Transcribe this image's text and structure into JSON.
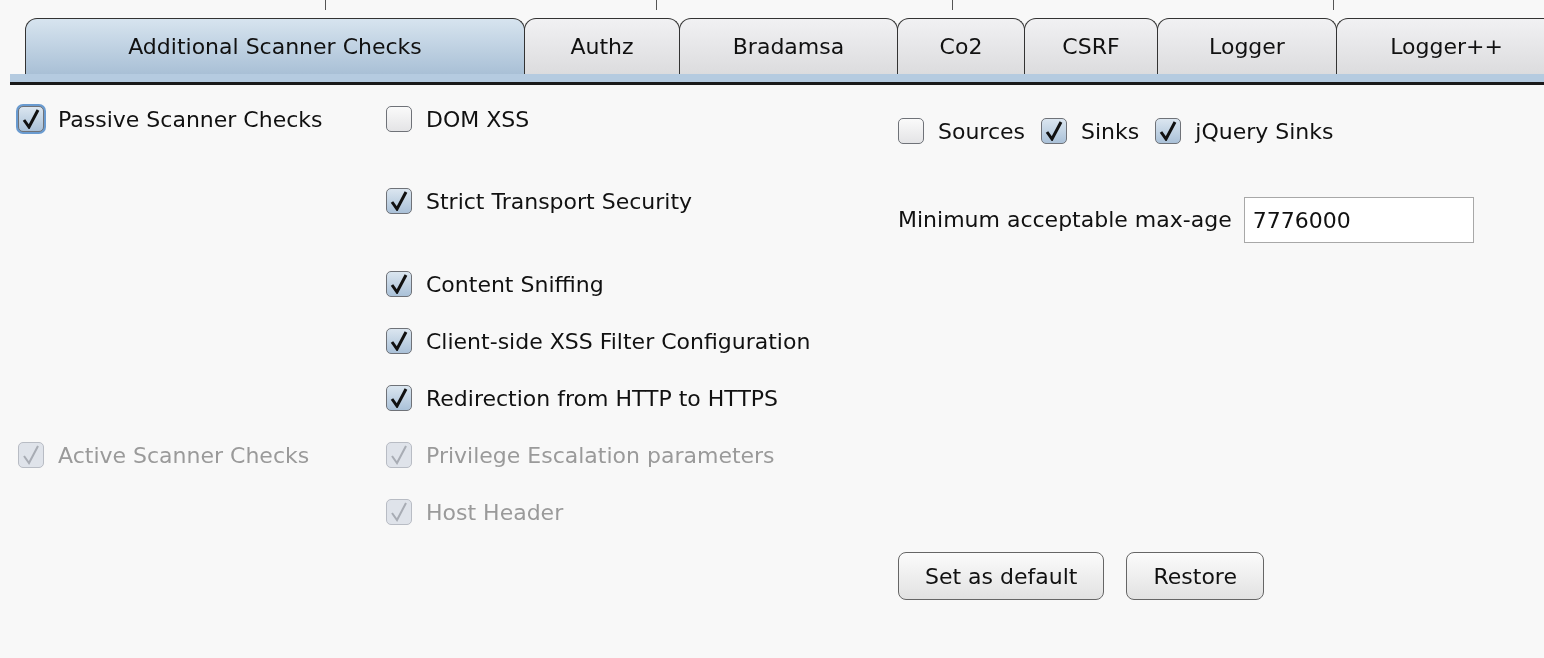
{
  "tabs": [
    {
      "label": "Additional Scanner Checks",
      "selected": true
    },
    {
      "label": "Authz",
      "selected": false
    },
    {
      "label": "Bradamsa",
      "selected": false
    },
    {
      "label": "Co2",
      "selected": false
    },
    {
      "label": "CSRF",
      "selected": false
    },
    {
      "label": "Logger",
      "selected": false
    },
    {
      "label": "Logger++",
      "selected": false
    }
  ],
  "passive_checks": {
    "label": "Passive Scanner Checks",
    "checked": true,
    "disabled": false,
    "focused": true
  },
  "passive_options": [
    {
      "label": "DOM XSS",
      "checked": false,
      "disabled": false
    },
    {
      "label": "Strict Transport Security",
      "checked": true,
      "disabled": false
    },
    {
      "label": "Content Sniffing",
      "checked": true,
      "disabled": false
    },
    {
      "label": "Client-side XSS Filter Configuration",
      "checked": true,
      "disabled": false
    },
    {
      "label": "Redirection from HTTP to HTTPS",
      "checked": true,
      "disabled": false
    }
  ],
  "dom_xss_options": [
    {
      "label": "Sources",
      "checked": false,
      "disabled": false
    },
    {
      "label": "Sinks",
      "checked": true,
      "disabled": false
    },
    {
      "label": "jQuery Sinks",
      "checked": true,
      "disabled": false
    }
  ],
  "max_age": {
    "label": "Minimum acceptable max-age",
    "value": "7776000"
  },
  "active_checks": {
    "label": "Active Scanner Checks",
    "checked": true,
    "disabled": true
  },
  "active_options": [
    {
      "label": "Privilege Escalation parameters",
      "checked": true,
      "disabled": true
    },
    {
      "label": "Host Header",
      "checked": true,
      "disabled": true
    }
  ],
  "buttons": [
    "Set as default",
    "Restore"
  ]
}
